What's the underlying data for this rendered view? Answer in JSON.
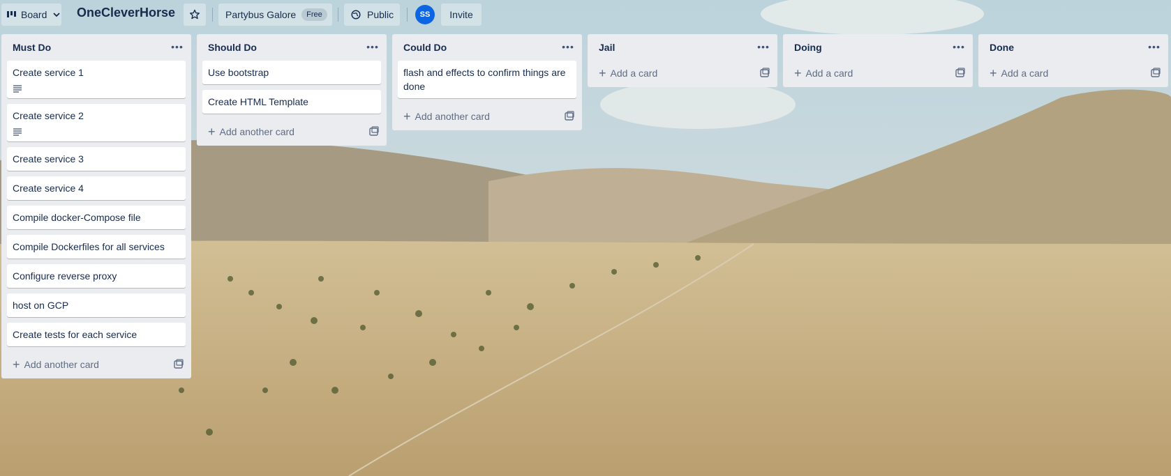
{
  "header": {
    "view_switcher_label": "Board",
    "board_title": "OneCleverHorse",
    "workspace_name": "Partybus Galore",
    "workspace_badge": "Free",
    "visibility_label": "Public",
    "avatar_initials": "SS",
    "invite_label": "Invite"
  },
  "lists": [
    {
      "title": "Must Do",
      "cards": [
        {
          "title": "Create service 1",
          "has_description": true
        },
        {
          "title": "Create service 2",
          "has_description": true
        },
        {
          "title": "Create service 3"
        },
        {
          "title": "Create service 4"
        },
        {
          "title": "Compile docker-Compose file"
        },
        {
          "title": "Compile Dockerfiles for all services"
        },
        {
          "title": "Configure reverse proxy"
        },
        {
          "title": "host on GCP"
        },
        {
          "title": "Create tests for each service"
        }
      ],
      "add_label": "Add another card"
    },
    {
      "title": "Should Do",
      "cards": [
        {
          "title": "Use bootstrap"
        },
        {
          "title": "Create HTML Template"
        }
      ],
      "add_label": "Add another card"
    },
    {
      "title": "Could Do",
      "cards": [
        {
          "title": "flash and effects to confirm things are done"
        }
      ],
      "add_label": "Add another card"
    },
    {
      "title": "Jail",
      "cards": [],
      "add_label": "Add a card"
    },
    {
      "title": "Doing",
      "cards": [],
      "add_label": "Add a card"
    },
    {
      "title": "Done",
      "cards": [],
      "add_label": "Add a card"
    }
  ],
  "icons": {
    "view_switcher": "board-icon",
    "star": "star-icon",
    "visibility": "globe-icon",
    "list_menu": "more-horizontal-icon",
    "add_card": "plus-icon",
    "template": "card-template-icon",
    "description": "description-lines-icon"
  },
  "colors": {
    "list_bg": "#ebecf0",
    "card_bg": "#ffffff",
    "text": "#172b4d",
    "avatar_bg": "#0c66e4"
  }
}
